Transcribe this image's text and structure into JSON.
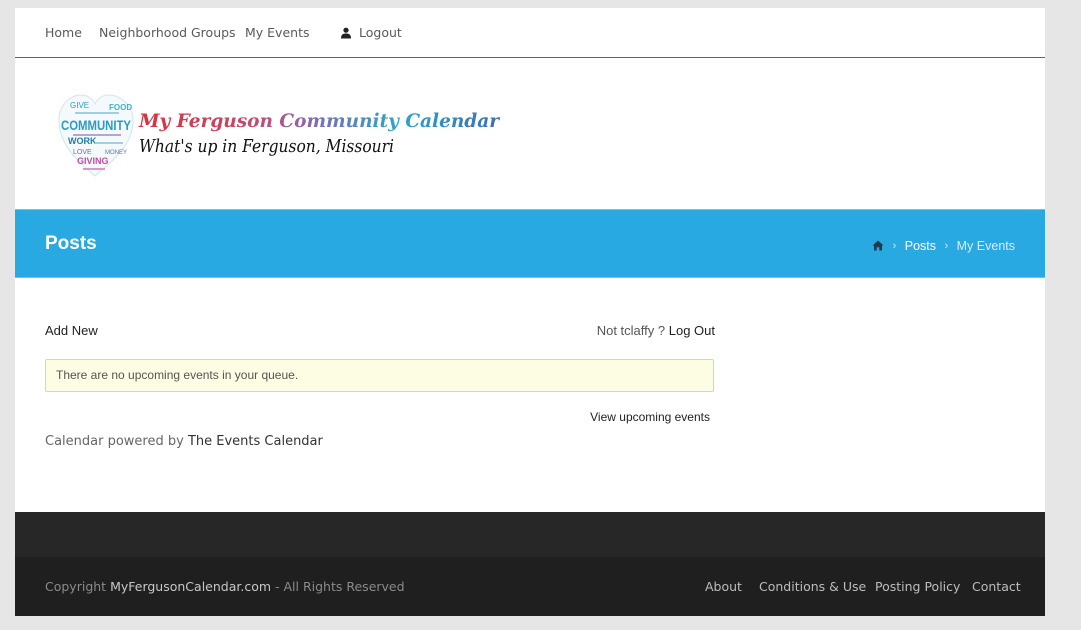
{
  "nav": {
    "home": "Home",
    "groups": "Neighborhood Groups",
    "my_events": "My Events",
    "logout": "Logout",
    "user_icon": "user-icon"
  },
  "header": {
    "logo_title": "My Ferguson Community Calendar",
    "logo_tagline": "What's up in Ferguson, Missouri",
    "heart_words": [
      "GIVE",
      "FOOD",
      "COMMUNITY",
      "WORK",
      "LOVE",
      "GIVING",
      "MONEY"
    ]
  },
  "titlebar": {
    "title": "Posts",
    "breadcrumb": {
      "home_icon": "home-icon",
      "separator": "›",
      "posts": "Posts",
      "current": "My Events"
    }
  },
  "content": {
    "add_new": "Add New",
    "not_user": "Not tclaffy ?",
    "log_out": "Log Out",
    "notice": "There are no upcoming events in your queue.",
    "view_upcoming": "View upcoming events",
    "powered_prefix": "Calendar powered by ",
    "powered_link": "The Events Calendar"
  },
  "footer": {
    "copyright_prefix": "Copyright ",
    "site": "MyFergusonCalendar.com",
    "copyright_suffix": " - All Rights Reserved",
    "links": [
      "About",
      "Conditions & Use",
      "Posting Policy",
      "Contact"
    ]
  },
  "colors": {
    "accent_blue": "#29a9e1",
    "nav_border": "#c2288c",
    "divider_green": "#8fd14f",
    "notice_bg": "#fdfde3"
  }
}
